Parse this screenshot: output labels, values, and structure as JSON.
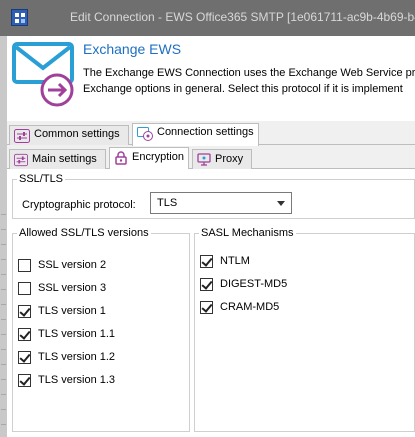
{
  "window": {
    "title": "Edit Connection - EWS Office365 SMTP [1e061711-ac9b-4b69-b4"
  },
  "header": {
    "title": "Exchange EWS",
    "description_line1": "The Exchange EWS Connection uses the Exchange Web Service pro",
    "description_line2": "Exchange options in general. Select this protocol if it is implement"
  },
  "top_tabs": [
    {
      "label": "Common settings",
      "icon": "settings-sliders-icon",
      "active": false
    },
    {
      "label": "Connection settings",
      "icon": "connection-settings-icon",
      "active": true
    }
  ],
  "sub_tabs": [
    {
      "label": "Main settings",
      "icon": "settings-sliders-icon",
      "active": false
    },
    {
      "label": "Encryption",
      "icon": "lock-icon",
      "active": true
    },
    {
      "label": "Proxy",
      "icon": "proxy-icon",
      "active": false
    }
  ],
  "ssl_tls": {
    "group_label": "SSL/TLS",
    "protocol_label": "Cryptographic protocol:",
    "protocol_value": "TLS"
  },
  "allowed_versions": {
    "group_label": "Allowed SSL/TLS versions",
    "items": [
      {
        "label": "SSL version 2",
        "checked": false
      },
      {
        "label": "SSL version 3",
        "checked": false
      },
      {
        "label": "TLS version 1",
        "checked": true
      },
      {
        "label": "TLS version 1.1",
        "checked": true
      },
      {
        "label": "TLS version 1.2",
        "checked": true
      },
      {
        "label": "TLS version 1.3",
        "checked": true
      }
    ]
  },
  "sasl": {
    "group_label": "SASL Mechanisms",
    "items": [
      {
        "label": "NTLM",
        "checked": true
      },
      {
        "label": "DIGEST-MD5",
        "checked": true
      },
      {
        "label": "CRAM-MD5",
        "checked": true
      }
    ]
  },
  "colors": {
    "accent_blue": "#1d6fc3",
    "icon_purple": "#a0409a",
    "icon_cyan": "#2a9fd6"
  }
}
